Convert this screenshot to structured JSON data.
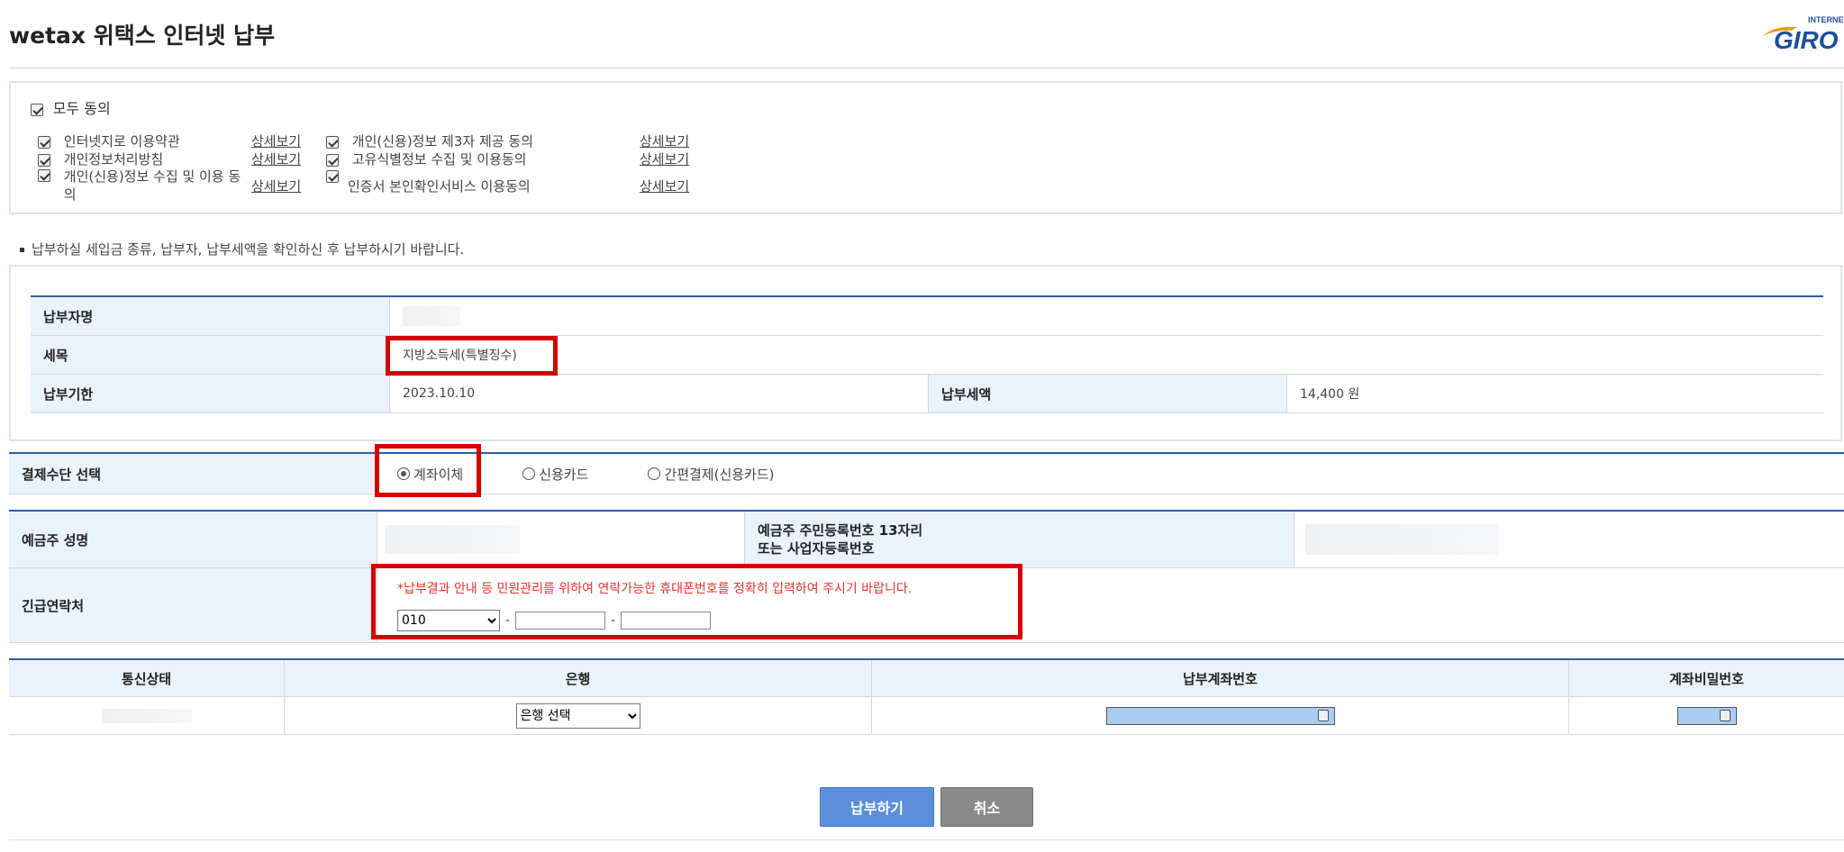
{
  "header": {
    "title": "wetax 위택스 인터넷 납부",
    "logo_top": "INTERNET",
    "logo_main": "GIRO"
  },
  "agreements": {
    "all_label": "모두 동의",
    "detail_label": "상세보기",
    "items": [
      {
        "label": "인터넷지로 이용약관",
        "checked": true
      },
      {
        "label": "개인정보처리방침",
        "checked": true
      },
      {
        "label": "개인(신용)정보 수집 및 이용 동의",
        "checked": true
      },
      {
        "label": "개인(신용)정보 제3자 제공 동의",
        "checked": true
      },
      {
        "label": "고유식별정보 수집 및 이용동의",
        "checked": true
      },
      {
        "label": "인증서 본인확인서비스 이용동의",
        "checked": true
      }
    ]
  },
  "notice": "납부하실 세입금 종류, 납부자, 납부세액을 확인하신 후 납부하시기 바랍니다.",
  "tax_info": {
    "payer_label": "납부자명",
    "tax_item_label": "세목",
    "tax_item_value": "지방소득세(특별징수)",
    "due_label": "납부기한",
    "due_value": "2023.10.10",
    "amount_label": "납부세액",
    "amount_value": "14,400 원"
  },
  "payment": {
    "label": "결제수단 선택",
    "options": [
      {
        "label": "계좌이체",
        "selected": true
      },
      {
        "label": "신용카드",
        "selected": false
      },
      {
        "label": "간편결제(신용카드)",
        "selected": false
      }
    ]
  },
  "depositor": {
    "name_label": "예금주 성명",
    "id_label_line1": "예금주 주민등록번호 13자리",
    "id_label_line2": "또는 사업자등록번호",
    "contact_label": "긴급연락처",
    "contact_notice": "*납부결과 안내 등 민원관리를 위하여 연락가능한 휴대폰번호를 정확히 입력하여 주시기 바랍니다.",
    "phone_prefix": "010",
    "dash": "-"
  },
  "bank_table": {
    "headers": [
      "통신상태",
      "은행",
      "납부계좌번호",
      "계좌비밀번호"
    ],
    "bank_select": "은행 선택"
  },
  "buttons": {
    "pay": "납부하기",
    "cancel": "취소"
  },
  "colors": {
    "accent_blue": "#2a5fa8",
    "header_cell_bg": "#eaf2fb",
    "highlight_red": "#d40000",
    "notice_red": "#e0352b",
    "pay_button": "#5b8fd9",
    "cancel_button": "#8a8a8a"
  }
}
